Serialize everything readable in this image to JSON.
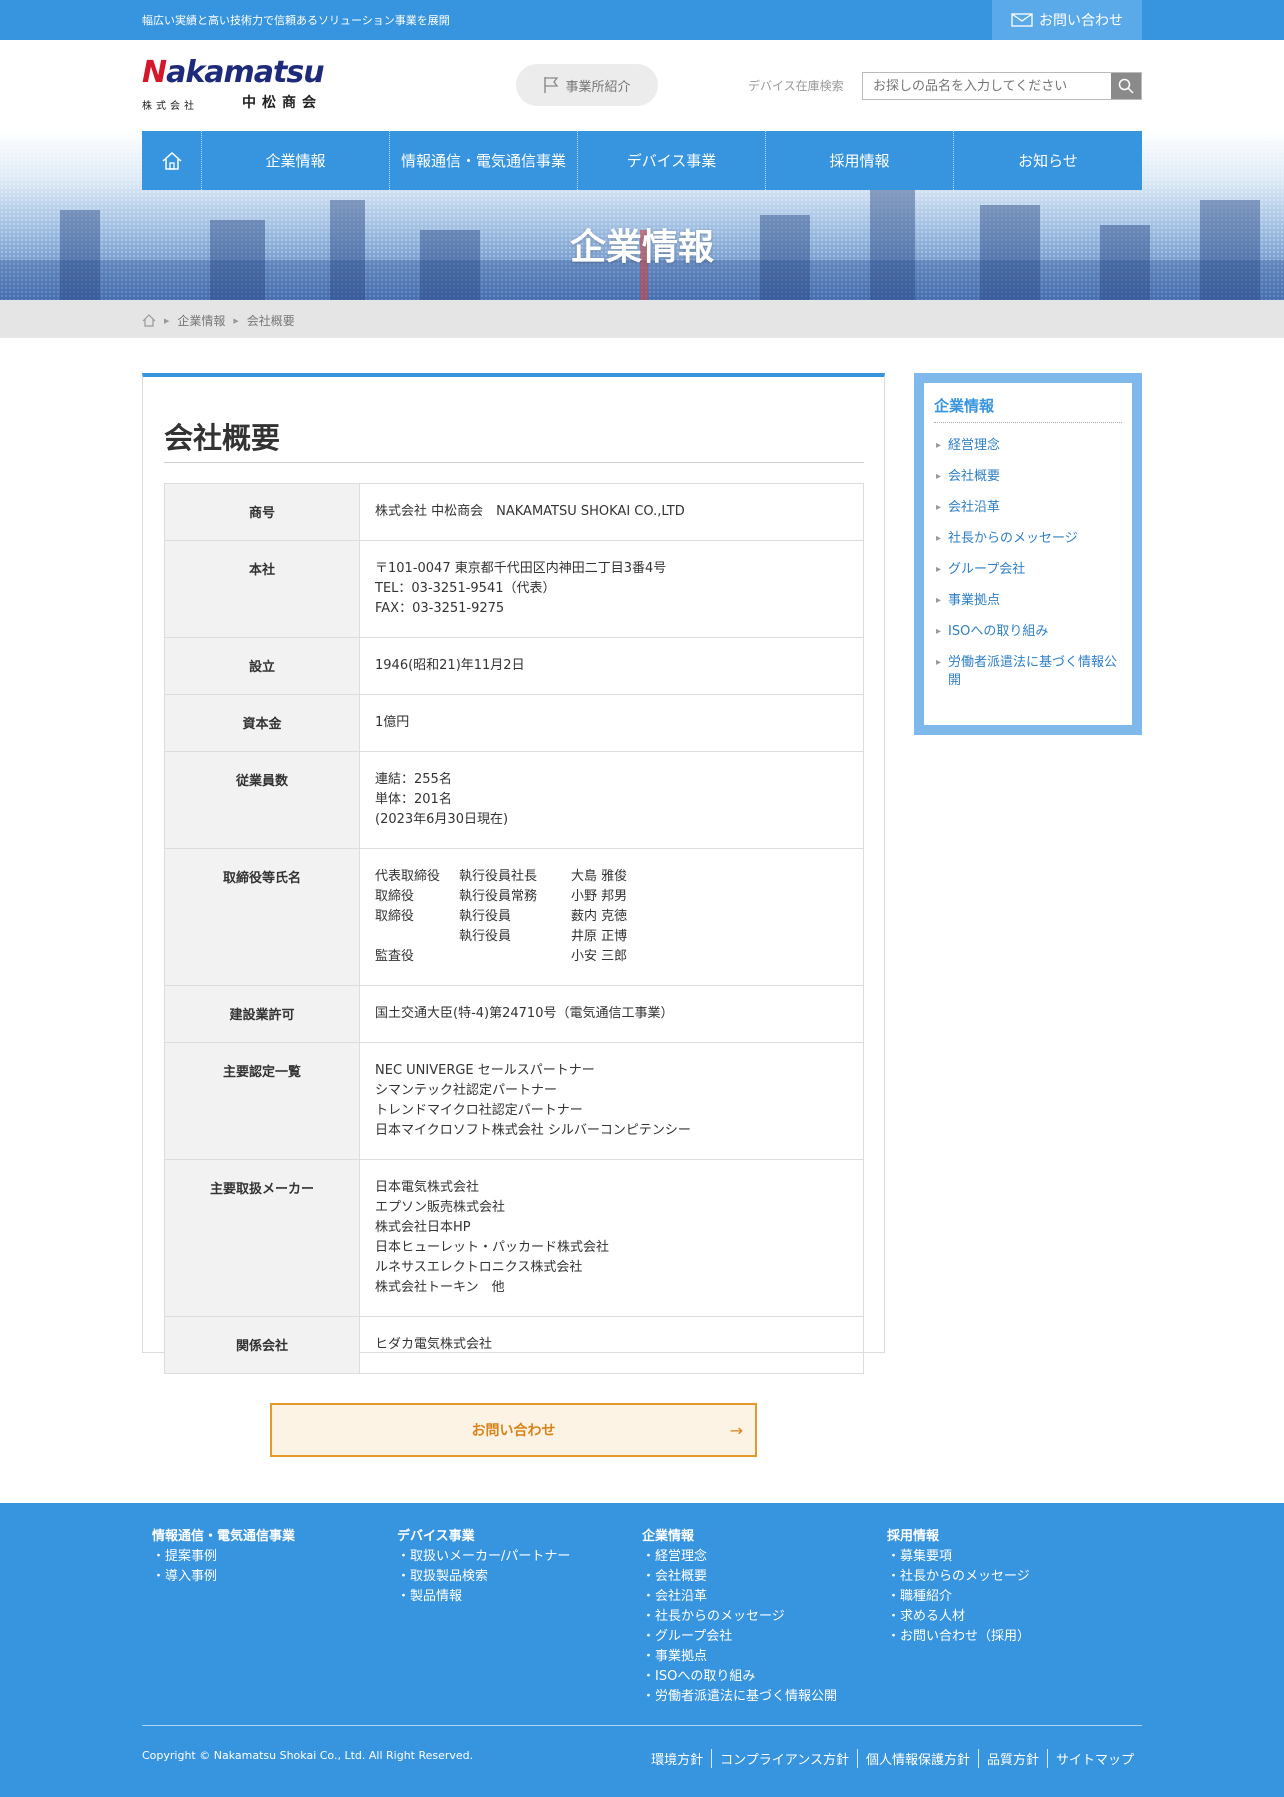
{
  "topbar": {
    "tagline": "幅広い実績と高い技術力で信頼あるソリューション事業を展開",
    "contact": "お問い合わせ"
  },
  "logo": {
    "wordmark": "Nakamatsu",
    "kabushiki": "株式会社",
    "name": "中松商会"
  },
  "header": {
    "office_button": "事業所紹介",
    "search_label": "デバイス在庫検索",
    "search_placeholder": "お探しの品名を入力してください"
  },
  "nav": {
    "items": [
      "企業情報",
      "情報通信・電気通信事業",
      "デバイス事業",
      "採用情報",
      "お知らせ"
    ]
  },
  "hero": {
    "title": "企業情報"
  },
  "breadcrumb": {
    "items": [
      "企業情報",
      "会社概要"
    ]
  },
  "main": {
    "title": "会社概要",
    "rows": [
      {
        "label": "商号",
        "lines": [
          "株式会社 中松商会　NAKAMATSU SHOKAI CO.,LTD"
        ]
      },
      {
        "label": "本社",
        "lines": [
          "〒101-0047 東京都千代田区内神田二丁目3番4号",
          "TEL：03-3251-9541（代表）",
          "FAX：03-3251-9275"
        ]
      },
      {
        "label": "設立",
        "lines": [
          "1946(昭和21)年11月2日"
        ]
      },
      {
        "label": "資本金",
        "lines": [
          "1億円"
        ]
      },
      {
        "label": "従業員数",
        "lines": [
          "連結：255名",
          "単体：201名",
          "(2023年6月30日現在)"
        ]
      },
      {
        "label": "取締役等氏名",
        "officers": [
          [
            "代表取締役",
            "執行役員社長",
            "大島 雅俊"
          ],
          [
            "取締役",
            "執行役員常務",
            "小野 邦男"
          ],
          [
            "取締役",
            "執行役員",
            "薮内 克徳"
          ],
          [
            "",
            "執行役員",
            "井原 正博"
          ],
          [
            "監査役",
            "",
            "小安 三郎"
          ]
        ]
      },
      {
        "label": "建設業許可",
        "lines": [
          "国土交通大臣(特-4)第24710号（電気通信工事業）"
        ]
      },
      {
        "label": "主要認定一覧",
        "lines": [
          "NEC UNIVERGE セールスパートナー",
          "シマンテック社認定パートナー",
          "トレンドマイクロ社認定パートナー",
          "日本マイクロソフト株式会社 シルバーコンピテンシー"
        ]
      },
      {
        "label": "主要取扱メーカー",
        "lines": [
          "日本電気株式会社",
          "エプソン販売株式会社",
          "株式会社日本HP",
          "日本ヒューレット・パッカード株式会社",
          "ルネサスエレクトロニクス株式会社",
          "株式会社トーキン　他"
        ]
      },
      {
        "label": "関係会社",
        "lines": [
          "ヒダカ電気株式会社"
        ]
      }
    ],
    "cta": "お問い合わせ"
  },
  "side": {
    "title": "企業情報",
    "items": [
      "経営理念",
      "会社概要",
      "会社沿革",
      "社長からのメッセージ",
      "グループ会社",
      "事業拠点",
      "ISOへの取り組み",
      "労働者派遣法に基づく情報公開"
    ]
  },
  "footer": {
    "columns": [
      {
        "heading": "情報通信・電気通信事業",
        "items": [
          "・提案事例",
          "・導入事例"
        ]
      },
      {
        "heading": "デバイス事業",
        "items": [
          "・取扱いメーカー/パートナー",
          "・取扱製品検索",
          "・製品情報"
        ]
      },
      {
        "heading": "企業情報",
        "items": [
          "・経営理念",
          "・会社概要",
          "・会社沿革",
          "・社長からのメッセージ",
          "・グループ会社",
          "・事業拠点",
          "・ISOへの取り組み",
          "・労働者派遣法に基づく情報公開"
        ]
      },
      {
        "heading": "採用情報",
        "items": [
          "・募集要項",
          "・社長からのメッセージ",
          "・職種紹介",
          "・求める人材",
          "・お問い合わせ（採用）"
        ]
      }
    ],
    "copyright": "Copyright © Nakamatsu Shokai Co., Ltd. All Right Reserved.",
    "links": [
      "環境方針",
      "コンプライアンス方針",
      "個人情報保護方針",
      "品質方針",
      "サイトマップ"
    ]
  },
  "colors": {
    "brand_blue": "#3794df",
    "cta_orange": "#e49a2a",
    "logo_navy": "#1e2a7a",
    "logo_red": "#d4172a"
  }
}
